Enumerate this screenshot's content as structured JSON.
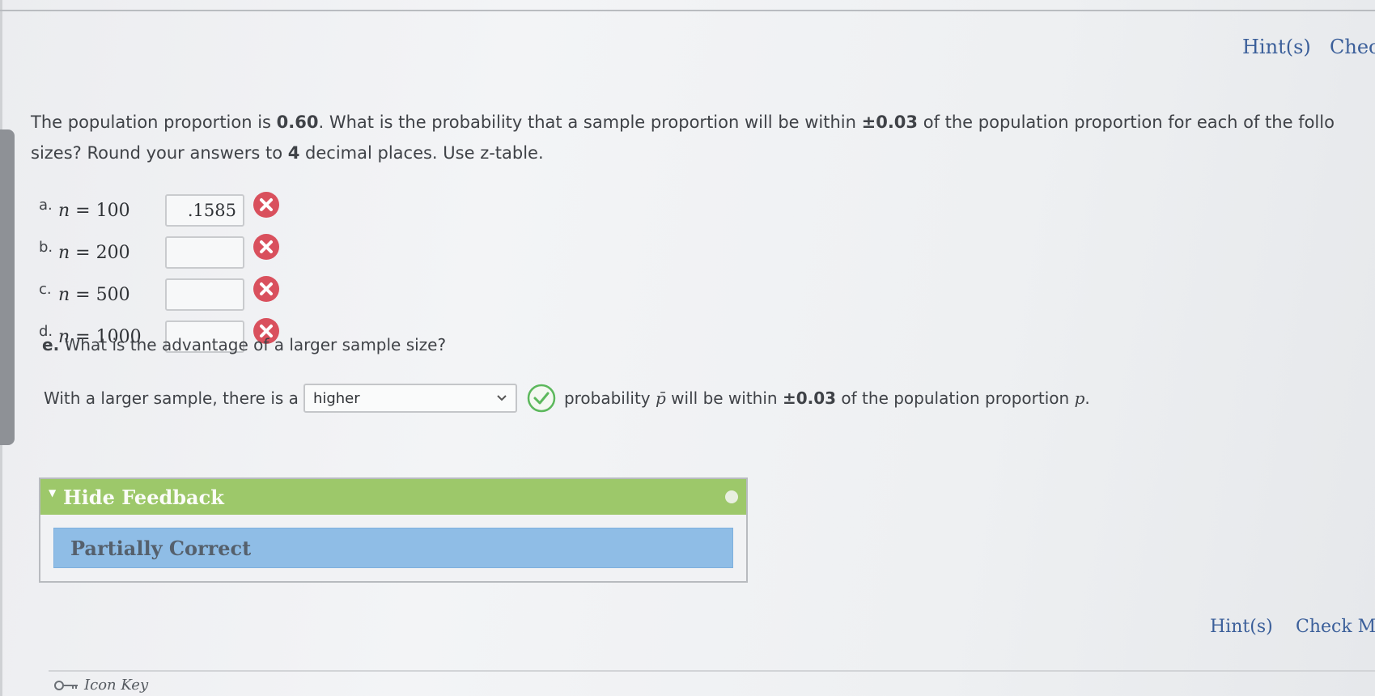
{
  "header": {
    "hints_label": "Hint(s)",
    "check_label": "Chec"
  },
  "question": {
    "text_1": "The population proportion is ",
    "proportion": "0.60",
    "text_2": ". What is the probability that a sample proportion will be within ",
    "margin": "±0.03",
    "text_3": " of the population proportion for each of the follo",
    "text_4": "sizes? Round your answers to ",
    "places": "4",
    "text_5": " decimal places. Use ",
    "table_link": "z-table",
    "text_6": "."
  },
  "parts": [
    {
      "letter": "a.",
      "var": "n",
      "eq": " = 100",
      "value": ".1585",
      "status": "incorrect"
    },
    {
      "letter": "b.",
      "var": "n",
      "eq": " = 200",
      "value": "",
      "status": "incorrect"
    },
    {
      "letter": "c.",
      "var": "n",
      "eq": " = 500",
      "value": "",
      "status": "incorrect"
    },
    {
      "letter": "d.",
      "var": "n",
      "eq": " = 1000",
      "value": "",
      "status": "incorrect"
    }
  ],
  "part_e": {
    "letter": "e.",
    "question": "What is the advantage of a larger sample size?",
    "sentence_start": "With a larger sample, there is a",
    "selected": "higher",
    "sentence_end_1": "probability ",
    "p_bar": "p̄",
    "sentence_end_2": " will be within ",
    "margin": "±0.03",
    "sentence_end_3": " of the population proportion ",
    "p": "p",
    "sentence_end_4": ".",
    "status": "correct"
  },
  "feedback": {
    "toggle_label": "Hide Feedback",
    "message": "Partially Correct"
  },
  "footer": {
    "hints_label": "Hint(s)",
    "check_label": "Check My",
    "icon_key_label": "Icon Key"
  },
  "colors": {
    "incorrect": "#d9505d",
    "correct": "#5cb85c",
    "feedback_header": "#9dc86a",
    "feedback_body": "#8fbde6",
    "link": "#3b5f9a"
  }
}
